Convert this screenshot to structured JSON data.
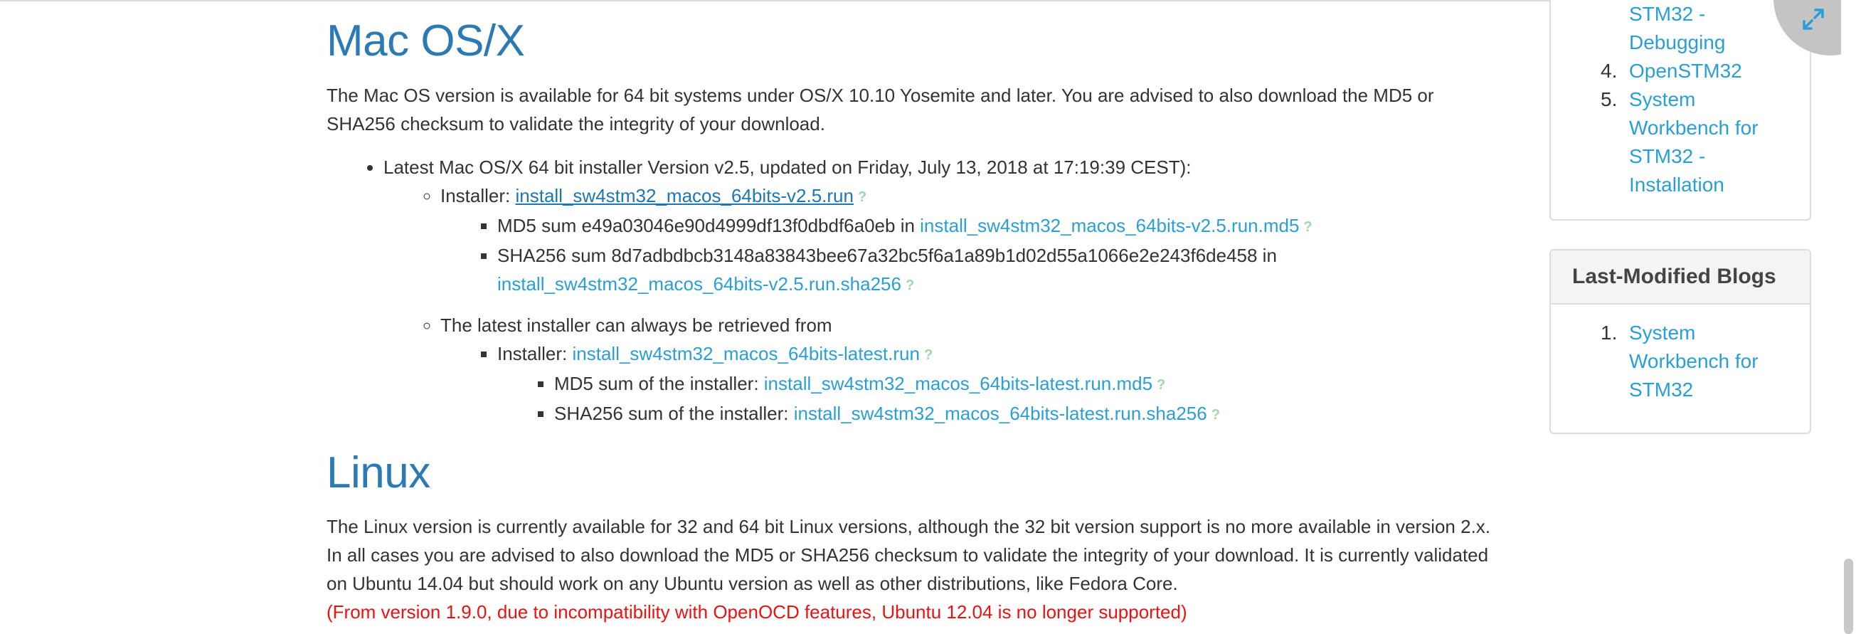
{
  "mac": {
    "title": "Mac OS/X",
    "description": "The Mac OS version is available for 64 bit systems under OS/X 10.10 Yosemite and later. You are advised to also download the MD5 or SHA256 checksum to validate the integrity of your download.",
    "latest_item": "Latest Mac OS/X 64 bit installer Version v2.5, updated on Friday, July 13, 2018 at 17:19:39 CEST):",
    "installer_label": "Installer: ",
    "installer_link": "install_sw4stm32_macos_64bits-v2.5.run",
    "md5_text": "MD5 sum e49a03046e90d4999df13f0dbdf6a0eb in ",
    "md5_link": "install_sw4stm32_macos_64bits-v2.5.run.md5",
    "sha_text": "SHA256 sum 8d7adbdbcb3148a83843bee67a32bc5f6a1a89b1d02d55a1066e2e243f6de458 in",
    "sha_link": "install_sw4stm32_macos_64bits-v2.5.run.sha256",
    "always_text": "The latest installer can always be retrieved from",
    "latest_installer_label": "Installer: ",
    "latest_installer_link": "install_sw4stm32_macos_64bits-latest.run",
    "latest_md5_label": "MD5 sum of the installer: ",
    "latest_md5_link": "install_sw4stm32_macos_64bits-latest.run.md5",
    "latest_sha_label": "SHA256 sum of the installer: ",
    "latest_sha_link": "install_sw4stm32_macos_64bits-latest.run.sha256",
    "help_glyph": "?"
  },
  "linux": {
    "title": "Linux",
    "description": "The Linux version is currently available for 32 and 64 bit Linux versions, although the 32 bit version support is no more available in version 2.x. In all cases you are advised to also download the MD5 or SHA256 checksum to validate the integrity of your download. It is currently validated on Ubuntu 14.04 but should work on any Ubuntu version as well as other distributions, like Fedora Core.",
    "warning": "(From version 1.9.0, due to incompatibility with OpenOCD features, Ubuntu 12.04 is no longer supported)"
  },
  "sidebar": {
    "toc_items": [
      {
        "num": "",
        "label": "STM32 - Debugging"
      },
      {
        "num": "4.",
        "label": "OpenSTM32"
      },
      {
        "num": "5.",
        "label": "System Workbench for STM32 - Installation"
      }
    ],
    "blogs_title": "Last-Modified Blogs",
    "blogs_items": [
      {
        "num": "1.",
        "label": "System Workbench for STM32"
      }
    ]
  },
  "icons": {
    "expand": "expand-icon",
    "help": "help-icon"
  },
  "colors": {
    "heading": "#2b7ab3",
    "link": "#2a9fd6",
    "warning": "#ee1111",
    "help": "#9dd9a8"
  }
}
